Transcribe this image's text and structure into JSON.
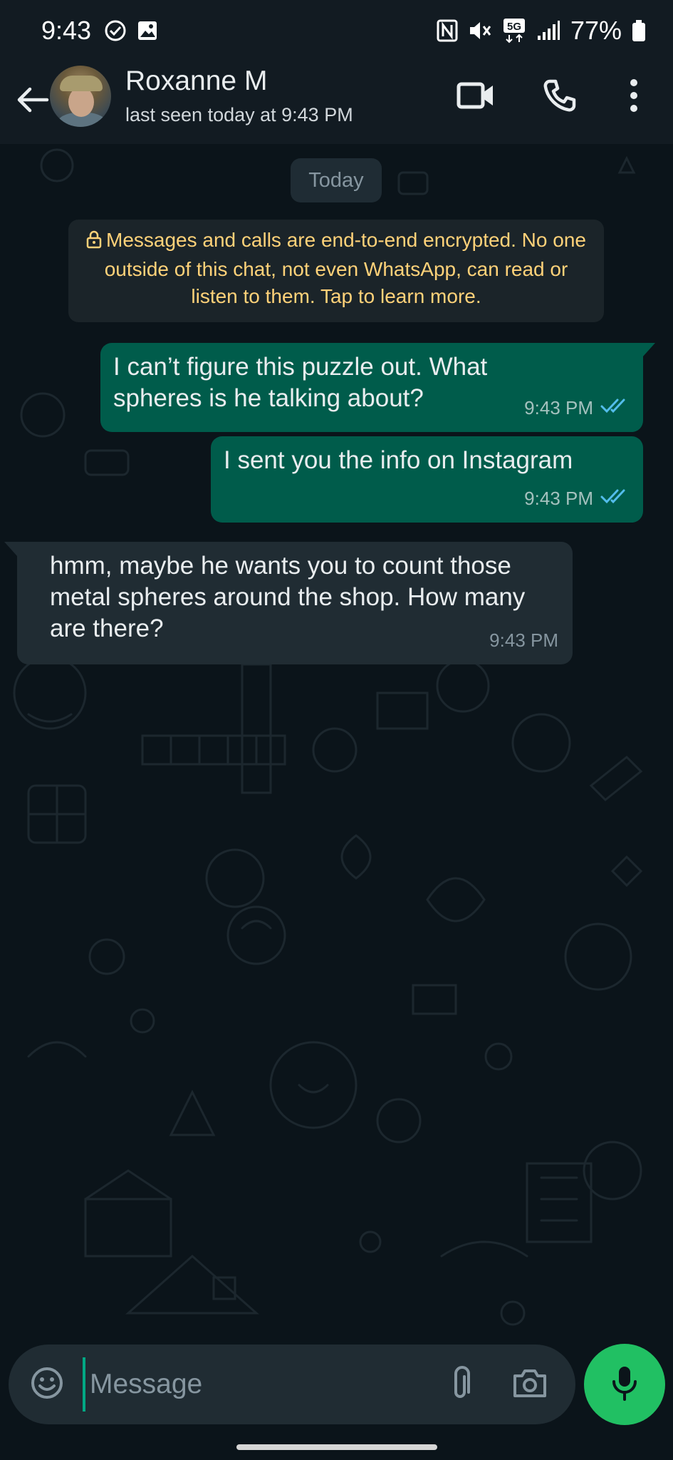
{
  "status_bar": {
    "time": "9:43",
    "battery_percent": "77%",
    "network": "5G",
    "icons": [
      "check-circle-icon",
      "image-icon",
      "nfc-icon",
      "mute-icon",
      "5g-icon",
      "signal-icon",
      "battery-icon"
    ]
  },
  "header": {
    "contact_name": "Roxanne M",
    "last_seen": "last seen today at 9:43 PM",
    "icons": [
      "back-arrow-icon",
      "video-call-icon",
      "phone-icon",
      "more-vert-icon"
    ]
  },
  "chat": {
    "date_chip": "Today",
    "encryption_notice": "Messages and calls are end-to-end encrypted. No one outside of this chat, not even WhatsApp, can read or listen to them. Tap to learn more.",
    "messages": [
      {
        "direction": "out",
        "text": "I can’t figure this puzzle out. What spheres is he talking about?",
        "time": "9:43 PM",
        "status": "read"
      },
      {
        "direction": "out",
        "text": "I sent you the info on Instagram",
        "time": "9:43 PM",
        "status": "read"
      },
      {
        "direction": "in",
        "text": "hmm, maybe he wants you to count those metal spheres around the shop. How many are there?",
        "time": "9:43 PM"
      }
    ]
  },
  "composer": {
    "placeholder": "Message",
    "value": "",
    "icons": [
      "emoji-icon",
      "paperclip-icon",
      "camera-icon",
      "mic-icon"
    ]
  },
  "colors": {
    "background": "#0b141a",
    "header": "#121b22",
    "outgoing_bubble": "#005c4b",
    "incoming_bubble": "#202c33",
    "accent": "#21c063",
    "read_ticks": "#53bdeb",
    "notice_text": "#ffd279"
  }
}
